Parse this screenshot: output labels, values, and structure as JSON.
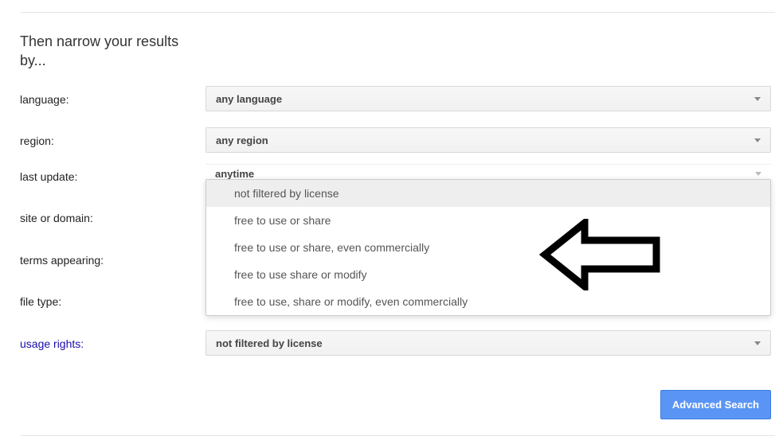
{
  "section_heading": "Then narrow your results by...",
  "fields": {
    "language": {
      "label": "language:",
      "value": "any language"
    },
    "region": {
      "label": "region:",
      "value": "any region"
    },
    "last_update": {
      "label": "last update:",
      "value": "anytime"
    },
    "site_or_domain": {
      "label": "site or domain:"
    },
    "terms_appearing": {
      "label": "terms appearing:"
    },
    "file_type": {
      "label": "file type:"
    },
    "usage_rights": {
      "label": "usage rights:",
      "value": "not filtered by license"
    }
  },
  "usage_rights_options": [
    "not filtered by license",
    "free to use or share",
    "free to use or share, even commercially",
    "free to use share or modify",
    "free to use, share or modify, even commercially"
  ],
  "button": {
    "advanced_search": "Advanced Search"
  }
}
